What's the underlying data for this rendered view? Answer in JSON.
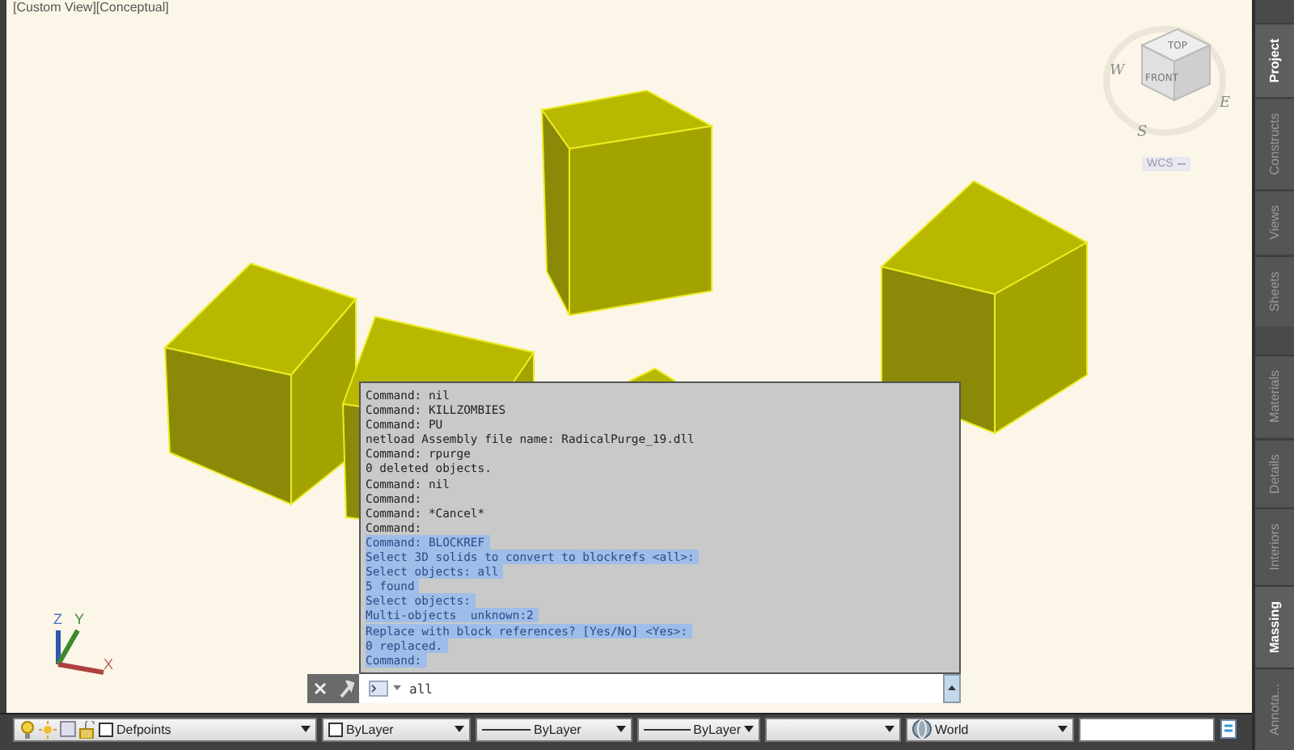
{
  "viewport": {
    "label": "[Custom View][Conceptual]",
    "viewcube": {
      "top": "TOP",
      "front": "FRONT",
      "west": "W",
      "east": "E",
      "south": "S",
      "wcs": "WCS"
    },
    "ucs": {
      "x": "X",
      "y": "Y",
      "z": "Z"
    }
  },
  "command_window": {
    "lines": [
      {
        "text": "Command: nil",
        "highlighted": false
      },
      {
        "text": "Command: KILLZOMBIES",
        "highlighted": false
      },
      {
        "text": "Command: PU",
        "highlighted": false
      },
      {
        "text": "netload Assembly file name: RadicalPurge_19.dll",
        "highlighted": false
      },
      {
        "text": "Command: rpurge",
        "highlighted": false
      },
      {
        "text": "0 deleted objects.",
        "highlighted": false
      },
      {
        "text": "Command: nil",
        "highlighted": false
      },
      {
        "text": "Command:",
        "highlighted": false
      },
      {
        "text": "Command: *Cancel*",
        "highlighted": false
      },
      {
        "text": "Command:",
        "highlighted": false
      },
      {
        "text": "Command: BLOCKREF",
        "highlighted": true
      },
      {
        "text": "Select 3D solids to convert to blockrefs <all>:",
        "highlighted": true
      },
      {
        "text": "Select objects: all",
        "highlighted": true
      },
      {
        "text": "5 found",
        "highlighted": true
      },
      {
        "text": "Select objects:",
        "highlighted": true
      },
      {
        "text": "Multi-objects  unknown:2",
        "highlighted": true
      },
      {
        "text": "Replace with block references? [Yes/No] <Yes>:",
        "highlighted": true
      },
      {
        "text": "0 replaced.",
        "highlighted": true
      },
      {
        "text": "Command:",
        "highlighted": true
      }
    ],
    "input": {
      "value": "all"
    }
  },
  "palette_tabs_top": [
    {
      "label": "Project",
      "selected": true
    },
    {
      "label": "Constructs",
      "selected": false
    },
    {
      "label": "Views",
      "selected": false
    },
    {
      "label": "Sheets",
      "selected": false
    }
  ],
  "palette_tabs_bottom": [
    {
      "label": "Materials",
      "selected": false
    },
    {
      "label": "Details",
      "selected": false
    },
    {
      "label": "Interiors",
      "selected": false
    },
    {
      "label": "Massing",
      "selected": true
    },
    {
      "label": "Annota...",
      "selected": false
    }
  ],
  "toolbar": {
    "layer": "Defpoints",
    "color_setting": "ByLayer",
    "linetype": "ByLayer",
    "lineweight": "ByLayer",
    "ucs": "World"
  }
}
